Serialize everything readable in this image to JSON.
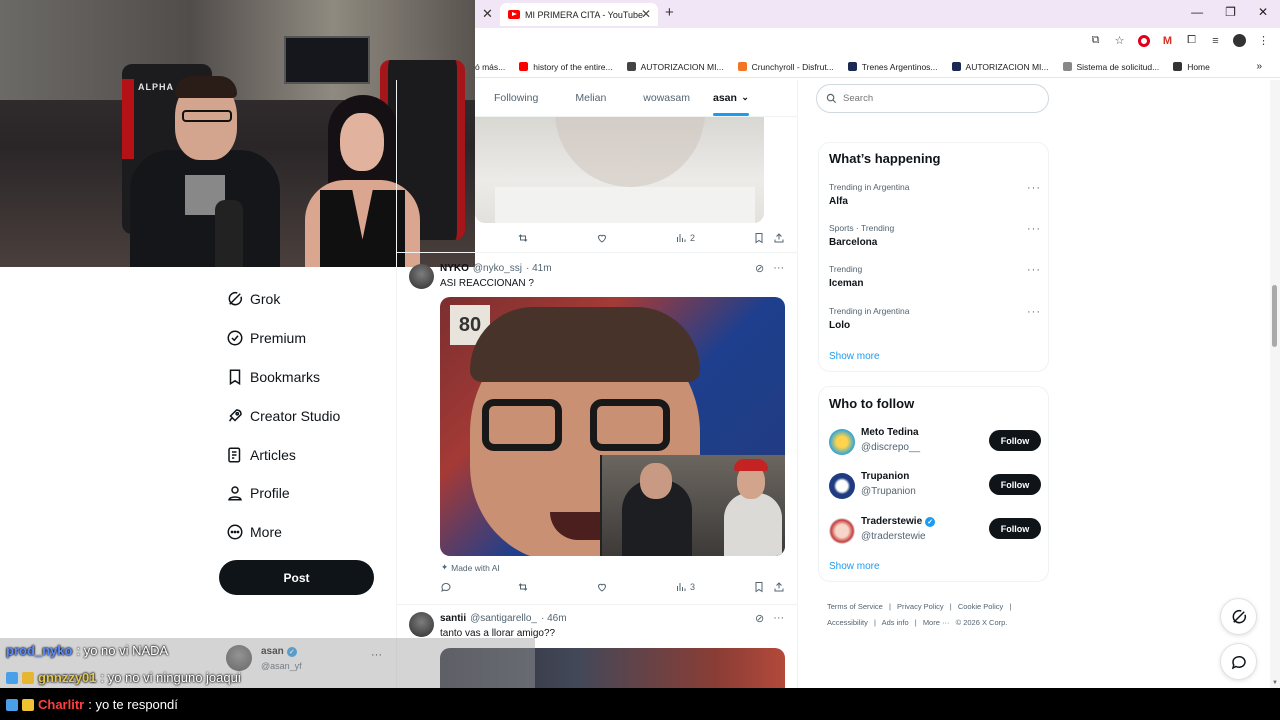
{
  "browser": {
    "tab_title": "MI PRIMERA CITA - YouTube",
    "bookmarks": [
      {
        "label": "ó más...",
        "color": ""
      },
      {
        "label": "history of the entire...",
        "color": "#ff0000"
      },
      {
        "label": "AUTORIZACION MI...",
        "color": "#444444"
      },
      {
        "label": "Crunchyroll - Disfrut...",
        "color": "#f47521"
      },
      {
        "label": "Trenes Argentinos...",
        "color": "#1a2a55"
      },
      {
        "label": "AUTORIZACION MI...",
        "color": "#1a2a55"
      },
      {
        "label": "Sistema de solicitud...",
        "color": "#888888"
      },
      {
        "label": "Home",
        "color": "#333333"
      }
    ]
  },
  "webcam": {
    "chair_logo": "ALPHA"
  },
  "sidebar": {
    "items": [
      {
        "label": "Grok",
        "icon": "grok-icon"
      },
      {
        "label": "Premium",
        "icon": "premium-icon"
      },
      {
        "label": "Bookmarks",
        "icon": "bookmark-icon"
      },
      {
        "label": "Creator Studio",
        "icon": "rocket-icon"
      },
      {
        "label": "Articles",
        "icon": "articles-icon"
      },
      {
        "label": "Profile",
        "icon": "profile-icon"
      },
      {
        "label": "More",
        "icon": "more-icon"
      }
    ],
    "post_label": "Post"
  },
  "feed": {
    "tabs": [
      "Following",
      "Melian",
      "wowasam",
      "asan"
    ],
    "tweet1": {
      "views": "2"
    },
    "tweet2": {
      "name": "NYKO",
      "handle": "@nyko_ssj",
      "time": "· 41m",
      "text": "ASI REACCIONAN ?",
      "made_with_ai": "Made with AI",
      "views": "3",
      "sign": "80"
    },
    "tweet3": {
      "name": "santii",
      "handle": "@santigarello_",
      "time": "· 46m",
      "text": "tanto vas a llorar amigo??"
    }
  },
  "right": {
    "search_placeholder": "Search",
    "whats_happening": "What’s happening",
    "trends": [
      {
        "meta": "Trending in Argentina",
        "title": "Alfa"
      },
      {
        "meta": "Sports · Trending",
        "title": "Barcelona"
      },
      {
        "meta": "Trending",
        "title": "Iceman"
      },
      {
        "meta": "Trending in Argentina",
        "title": "Lolo"
      }
    ],
    "show_more": "Show more",
    "who_to_follow": "Who to follow",
    "follow_suggestions": [
      {
        "name": "Meto Tedina",
        "handle": "@discrepo__",
        "verified": false
      },
      {
        "name": "Trupanion",
        "handle": "@Trupanion",
        "verified": false
      },
      {
        "name": "Traderstewie",
        "handle": "@traderstewie",
        "verified": true
      }
    ],
    "follow_label": "Follow",
    "footer": [
      "Terms of Service",
      "|",
      "Privacy Policy",
      "|",
      "Cookie Policy",
      "|",
      "Accessibility",
      "|",
      "Ads info",
      "|",
      "More ···",
      "© 2026 X Corp."
    ]
  },
  "account": {
    "name": "asan",
    "handle": "@asan_yf"
  },
  "chat": [
    {
      "user": "prod_nyko",
      "message": ": yo no vi NADA",
      "color": "#5b8cff"
    },
    {
      "user": "gnnzzy01",
      "message": ": yo no vi ninguno joaqui",
      "color": "#e3c84b"
    },
    {
      "user": "Charlitr",
      "message": ": yo te respondí",
      "color": "#ff4040"
    }
  ]
}
